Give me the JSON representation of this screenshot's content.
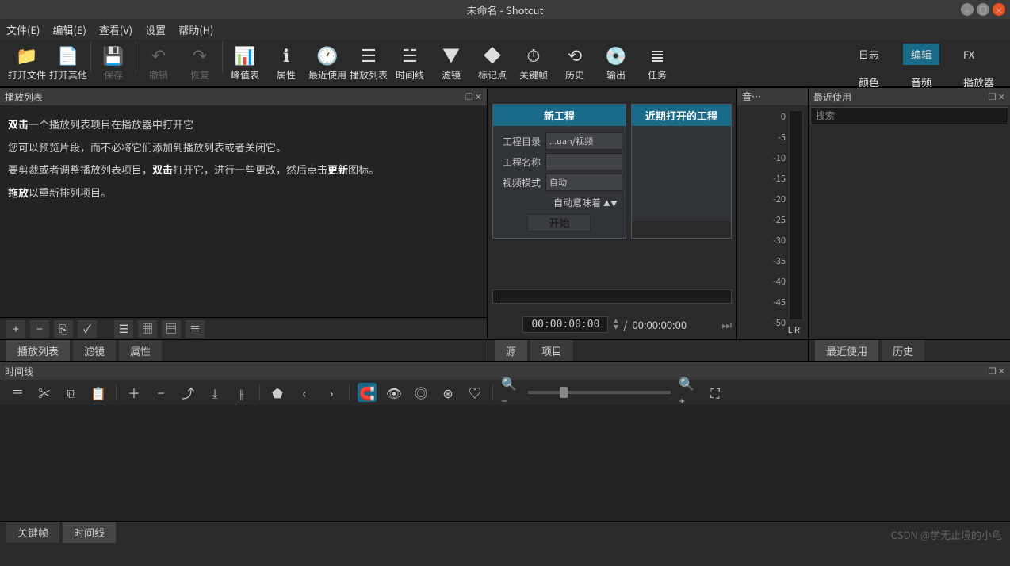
{
  "window": {
    "title": "未命名 - Shotcut"
  },
  "menus": {
    "file": "文件(E)",
    "edit": "编辑(E)",
    "view": "查看(V)",
    "settings": "设置",
    "help": "帮助(H)"
  },
  "toolbar": {
    "open_file": "打开文件",
    "open_other": "打开其他",
    "save": "保存",
    "undo": "撤销",
    "redo": "恢复",
    "peak_meter": "峰值表",
    "properties": "属性",
    "recent": "最近使用",
    "playlist": "播放列表",
    "timeline": "时间线",
    "filters": "滤镜",
    "markers": "标记点",
    "keyframes": "关键帧",
    "history": "历史",
    "export": "输出",
    "jobs": "任务"
  },
  "right_tabs": {
    "log": "日志",
    "edit": "编辑",
    "fx": "FX",
    "color": "颜色",
    "audio": "音频",
    "player": "播放器"
  },
  "playlist_panel": {
    "title": "播放列表",
    "hint1a": "双击",
    "hint1b": "一个播放列表项目在播放器中打开它",
    "hint2": "您可以预览片段，而不必将它们添加到播放列表或者关闭它。",
    "hint3a": "要剪裁或者调整播放列表项目，",
    "hint3b": "双击",
    "hint3c": "打开它，进行一些更改，然后点击",
    "hint3d": "更新",
    "hint3e": "图标。",
    "hint4a": "拖放",
    "hint4b": "以重新排列项目。"
  },
  "bottom_tabs": {
    "playlist": "播放列表",
    "filters": "滤镜",
    "properties": "属性"
  },
  "project": {
    "new_title": "新工程",
    "recent_title": "近期打开的工程",
    "folder_label": "工程目录",
    "folder_value": "...uan/视频",
    "name_label": "工程名称",
    "name_value": "",
    "mode_label": "视频模式",
    "mode_value": "自动",
    "auto_hint": "自动意味着",
    "start": "开始"
  },
  "player": {
    "time_current": "00:00:00:00",
    "time_total": "00:00:00:00",
    "sep": "/",
    "source_tab": "源",
    "project_tab": "项目"
  },
  "audio_panel": {
    "title": "音…",
    "scale": [
      "0",
      "-5",
      "-10",
      "-15",
      "-20",
      "-25",
      "-30",
      "-35",
      "-40",
      "-45",
      "-50"
    ],
    "lr": "L  R"
  },
  "recent_panel": {
    "title": "最近使用",
    "search_placeholder": "搜索"
  },
  "recent_tabs": {
    "recent": "最近使用",
    "history": "历史"
  },
  "timeline": {
    "title": "时间线"
  },
  "footer_tabs": {
    "keyframes": "关键帧",
    "timeline": "时间线"
  },
  "watermark": "CSDN @学无止境的小龟"
}
